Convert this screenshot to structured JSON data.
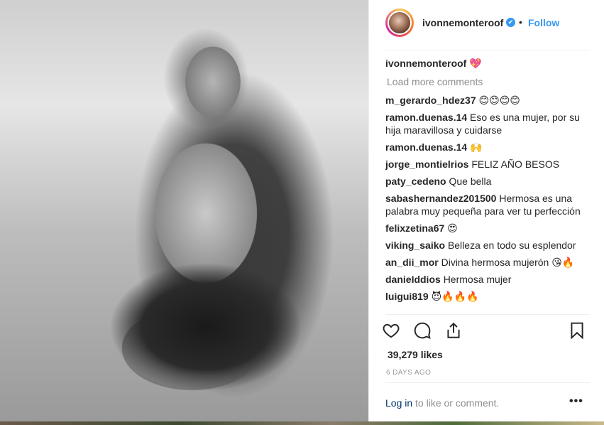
{
  "post": {
    "username": "ivonnemonteroof",
    "verified_glyph": "✔",
    "dot": "•",
    "follow_label": "Follow"
  },
  "caption": {
    "user": "ivonnemonteroof",
    "text": "💖"
  },
  "load_more_label": "Load more comments",
  "comments": [
    {
      "user": "m_gerardo_hdez37",
      "text": "😊😊😊😊"
    },
    {
      "user": "ramon.duenas.14",
      "text": "Eso es una mujer, por su hija maravillosa y cuidarse"
    },
    {
      "user": "ramon.duenas.14",
      "text": "🙌"
    },
    {
      "user": "jorge_montielrios",
      "text": "FELIZ AÑO BESOS"
    },
    {
      "user": "paty_cedeno",
      "text": "Que bella"
    },
    {
      "user": "sabashernandez201500",
      "text": "Hermosa es una palabra muy pequeña para ver tu perfección"
    },
    {
      "user": "felixzetina67",
      "text": "😍"
    },
    {
      "user": "viking_saiko",
      "text": "Belleza en todo su esplendor"
    },
    {
      "user": "an_dii_mor",
      "text": "Divina hermosa mujerón 😘🔥"
    },
    {
      "user": "danieIddios",
      "text": "Hermosa mujer"
    },
    {
      "user": "luigui819",
      "text": "😈🔥🔥🔥"
    }
  ],
  "stats": {
    "likes": "39,279 likes",
    "time_ago": "6 DAYS AGO"
  },
  "footer": {
    "login_label": "Log in",
    "login_suffix": " to like or comment.",
    "more_label": "•••"
  },
  "icons": {
    "like": "heart-icon",
    "comment": "comment-icon",
    "share": "share-icon",
    "save": "bookmark-icon"
  },
  "colors": {
    "accent": "#3897f0",
    "text": "#262626",
    "muted": "#8e8e8e",
    "link": "#003569"
  }
}
